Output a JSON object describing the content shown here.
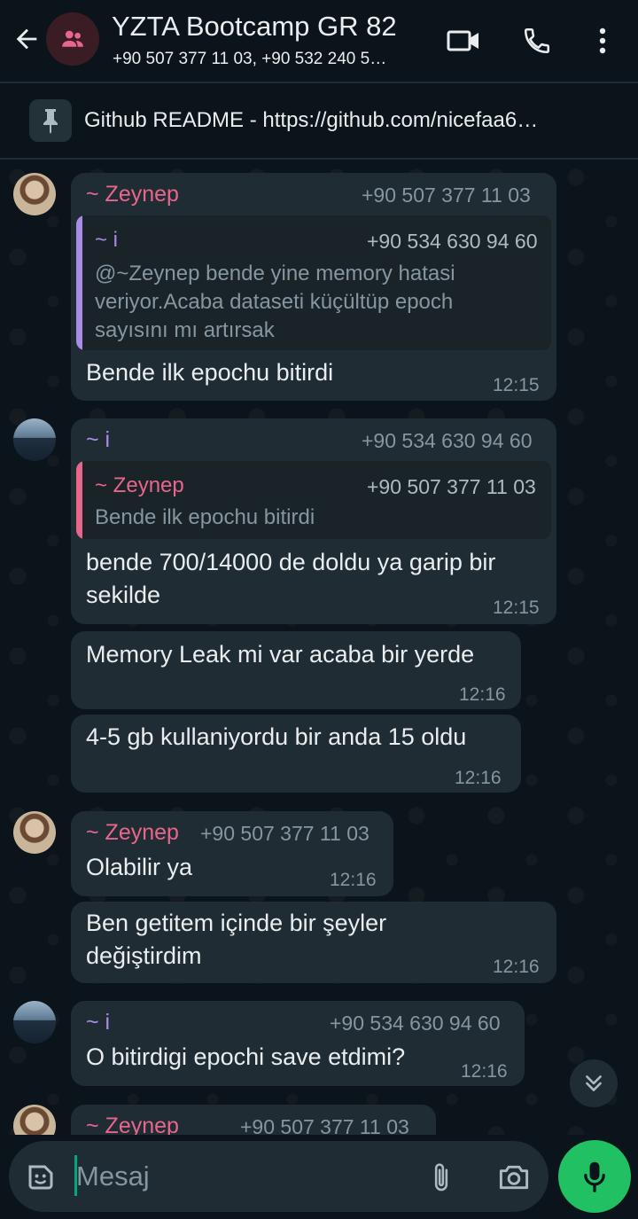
{
  "header": {
    "title": "YZTA Bootcamp GR 82",
    "subtitle": "+90 507 377 11 03, +90 532 240 5…",
    "icons": [
      "back-arrow-icon",
      "group-avatar-icon",
      "video-call-icon",
      "phone-call-icon",
      "more-options-icon"
    ]
  },
  "pinned": {
    "text": "Github README - https://github.com/nicefaa6…",
    "icon": "pin-icon"
  },
  "messages": [
    {
      "sender": "~ Zeynep",
      "phone": "+90 507 377 11 03",
      "quote_sender": "~ i",
      "quote_phone": "+90 534 630 94 60",
      "quote_text": "@~Zeynep bende yine memory hatasi veriyor.Acaba dataseti küçültüp epoch sayısını mı artırsak",
      "text": "Bende ilk epochu bitirdi",
      "time": "12:15"
    },
    {
      "sender": "~ i",
      "phone": "+90 534 630 94 60",
      "quote_sender": "~ Zeynep",
      "quote_phone": "+90 507 377 11 03",
      "quote_text": "Bende ilk epochu bitirdi",
      "text": "bende 700/14000 de doldu ya garip bir sekilde",
      "time": "12:15"
    },
    {
      "text": "Memory Leak mi var acaba bir yerde",
      "time": "12:16"
    },
    {
      "text": "4-5 gb kullaniyordu bir anda 15 oldu",
      "time": "12:16"
    },
    {
      "sender": "~ Zeynep",
      "phone": "+90 507 377 11 03",
      "text": "Olabilir ya",
      "time": "12:16"
    },
    {
      "text": "Ben getitem içinde bir şeyler değiştirdim",
      "time": "12:16"
    },
    {
      "sender": "~ i",
      "phone": "+90 534 630 94 60",
      "text": "O bitirdigi epochi save etdimi?",
      "time": "12:16"
    },
    {
      "sender": "~ Zeynep",
      "phone": "+90 507 377 11 03"
    }
  ],
  "input": {
    "placeholder": "Mesaj",
    "icons": [
      "sticker-icon",
      "attach-icon",
      "camera-icon",
      "mic-icon",
      "scroll-down-icon"
    ]
  },
  "colors": {
    "background": "#0b141a",
    "bubble": "#202c33",
    "zeynep": "#e8668c",
    "i": "#a98ce6",
    "accent": "#21c063"
  }
}
